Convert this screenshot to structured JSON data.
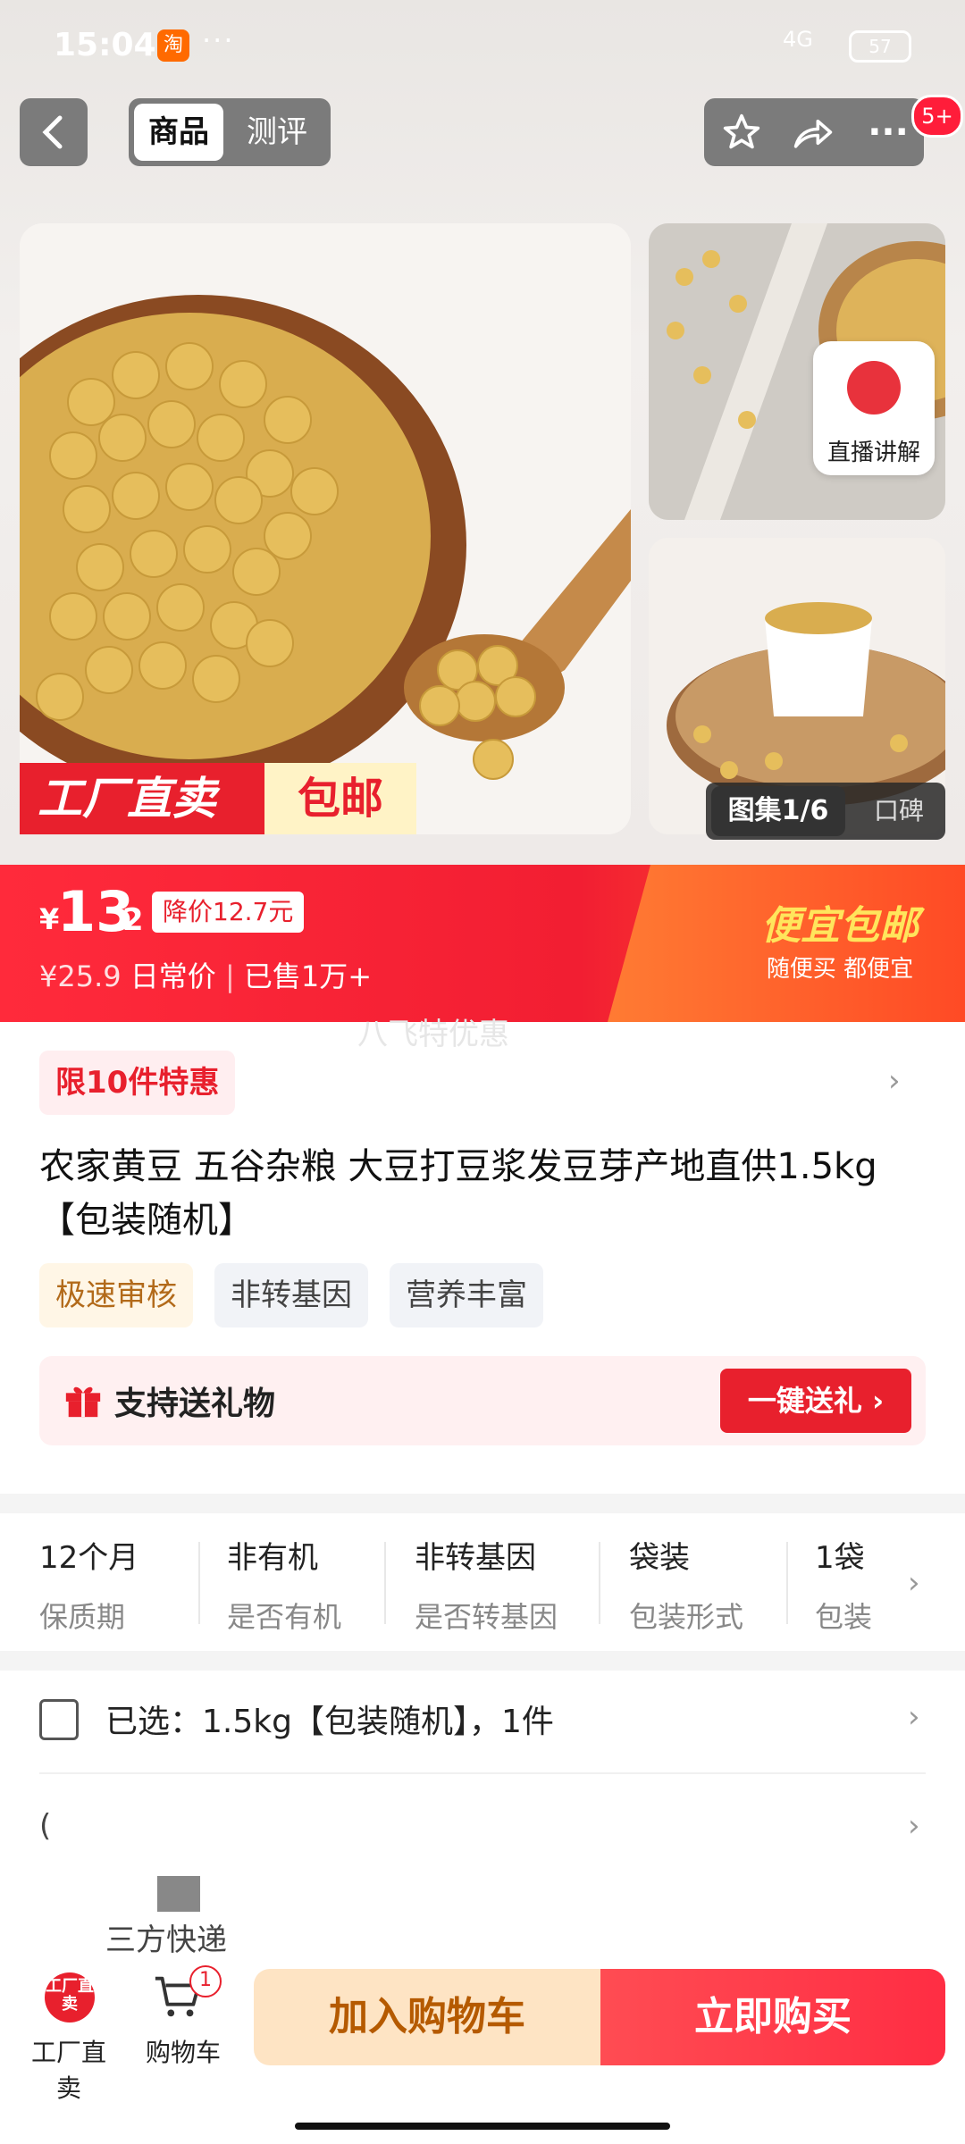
{
  "status_bar": {
    "time": "15:04",
    "app_icon": "淘",
    "dots": "···",
    "network": "4G",
    "battery": "57"
  },
  "header": {
    "tabs": [
      {
        "label": "商品",
        "active": true
      },
      {
        "label": "测评",
        "active": false
      }
    ],
    "actions": [
      "star-icon",
      "share-icon",
      "more-icon"
    ],
    "badge": "5+"
  },
  "gallery": {
    "tag_factory": "工厂直卖",
    "tag_free_ship": "包邮",
    "live_label": "直播讲解",
    "gallery_btn": "图集1/6",
    "reviews_btn": "口碑"
  },
  "price": {
    "currency": "¥",
    "integer": "13",
    "decimal": ".2",
    "drop_badge": "降价12.7元",
    "original": "¥25.9",
    "daily_label": "日常价",
    "sold": "已售1万+",
    "promo_title": "便宜包邮",
    "promo_sub": "随便买 都便宜",
    "watermark": "八飞特优惠"
  },
  "limit_tag": "限10件特惠",
  "title": "农家黄豆 五谷杂粮 大豆打豆浆发豆芽产地直供1.5kg【包装随机】",
  "tags": [
    "极速审核",
    "非转基因",
    "营养丰富"
  ],
  "gift": {
    "text": "支持送礼物",
    "button": "一键送礼"
  },
  "attributes": [
    {
      "value": "12个月",
      "key": "保质期"
    },
    {
      "value": "非有机",
      "key": "是否有机"
    },
    {
      "value": "非转基因",
      "key": "是否转基因"
    },
    {
      "value": "袋装",
      "key": "包装形式"
    },
    {
      "value": "1袋",
      "key": "包装"
    }
  ],
  "selection": "已选：1.5kg【包装随机】，1件",
  "shipping_fragment": "(",
  "shipping_label": "三方快递",
  "bottom": {
    "factory_label": "工厂直卖",
    "factory_icon_text": "工厂直卖",
    "cart_label": "购物车",
    "cart_count": "1",
    "add_to_cart": "加入购物车",
    "buy_now": "立即购买"
  }
}
